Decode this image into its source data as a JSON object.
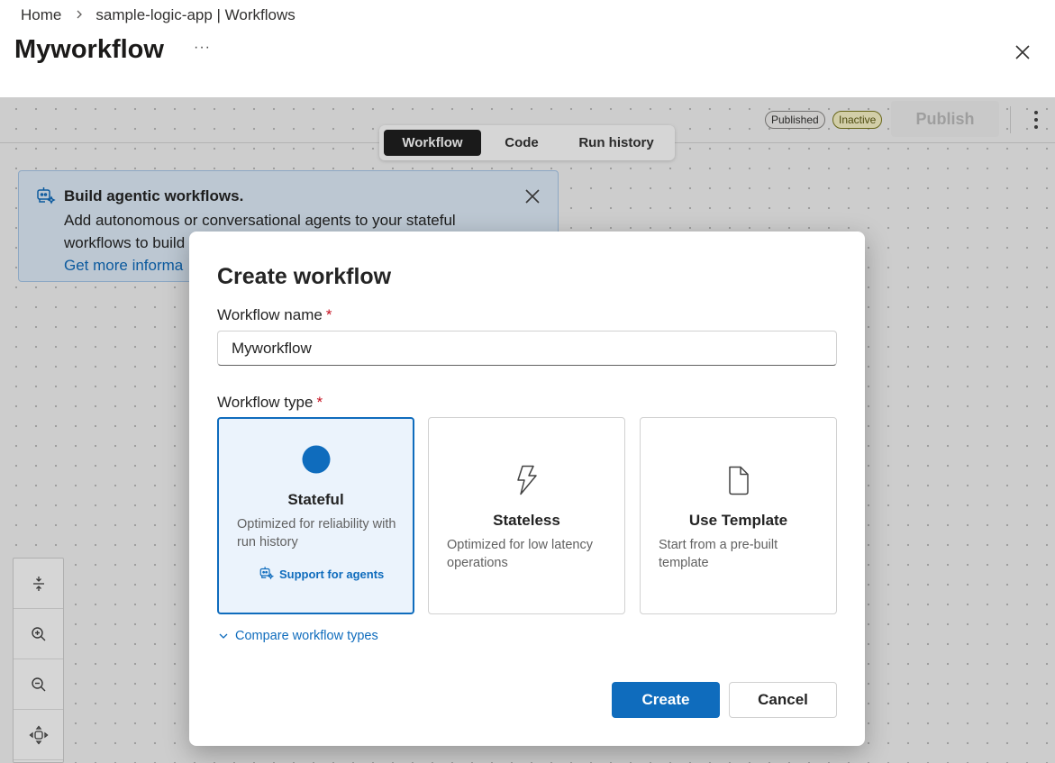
{
  "breadcrumb": {
    "home": "Home",
    "current": "sample-logic-app | Workflows"
  },
  "page": {
    "title": "Myworkflow",
    "more": "···"
  },
  "toolbar": {
    "published_badge": "Published",
    "inactive_badge": "Inactive",
    "publish_label": "Publish"
  },
  "tabs": [
    {
      "label": "Workflow",
      "active": true
    },
    {
      "label": "Code",
      "active": false
    },
    {
      "label": "Run history",
      "active": false
    }
  ],
  "banner": {
    "title": "Build agentic workflows.",
    "text": "Add autonomous or conversational agents to your stateful workflows to build",
    "link": "Get more informa"
  },
  "dialog": {
    "title": "Create workflow",
    "name_label": "Workflow name",
    "required_mark": "*",
    "name_value": "Myworkflow",
    "type_label": "Workflow type",
    "cards": [
      {
        "title": "Stateful",
        "desc": "Optimized for reliability with run history",
        "extra": "Support for agents",
        "selected": true
      },
      {
        "title": "Stateless",
        "desc": "Optimized for low latency operations",
        "selected": false
      },
      {
        "title": "Use Template",
        "desc": "Start from a pre-built template",
        "selected": false
      }
    ],
    "compare_link": "Compare workflow types",
    "create_label": "Create",
    "cancel_label": "Cancel"
  },
  "colors": {
    "accent": "#0f6cbd",
    "danger": "#c50f1f",
    "selected_bg": "#ebf3fc"
  },
  "icons": [
    "chevron-right-icon",
    "more-icon",
    "close-icon",
    "kebab-icon",
    "agent-icon",
    "fit-icon",
    "zoom-in-icon",
    "zoom-out-icon",
    "pan-icon",
    "circle-icon",
    "lightning-icon",
    "document-icon",
    "chevron-down-icon"
  ]
}
